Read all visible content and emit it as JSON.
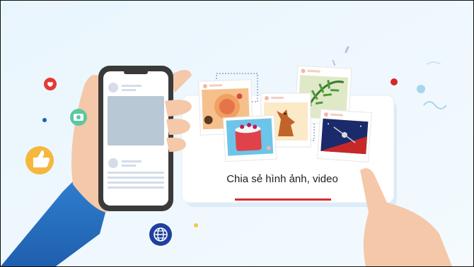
{
  "card": {
    "caption": "Chia sẻ hình ảnh, video"
  },
  "colors": {
    "background": "#eef7fd",
    "accent_red": "#d32f2f",
    "card": "#ffffff",
    "phone_frame": "#3a3a3a",
    "globe_badge": "#1f3fa0"
  },
  "icons": [
    "heart-icon",
    "camera-icon",
    "like-hand-icon",
    "globe-icon"
  ]
}
